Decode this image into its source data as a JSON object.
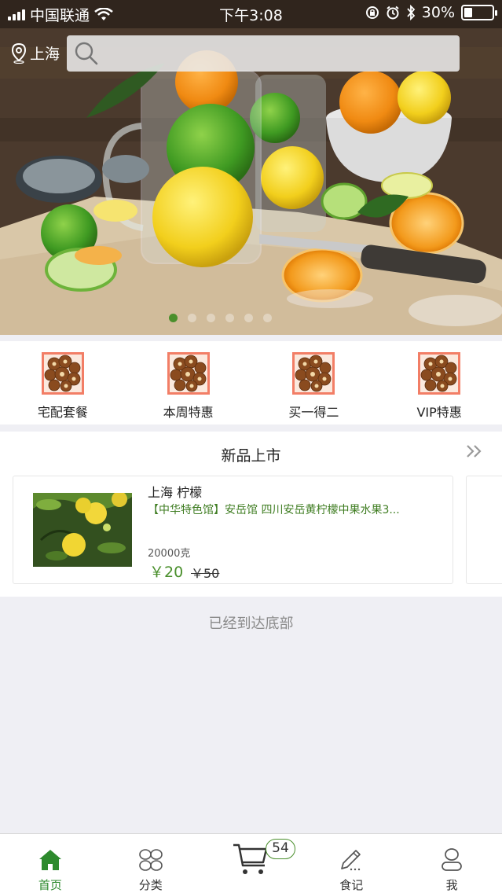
{
  "status_bar": {
    "carrier": "中国联通",
    "time": "下午3:08",
    "battery": "30%",
    "battery_level": 0.3
  },
  "header": {
    "location": "上海",
    "search_placeholder": ""
  },
  "banner": {
    "slide_count": 6,
    "active_slide": 1
  },
  "categories": [
    {
      "label": "宅配套餐",
      "icon": "pastry-thumbnail"
    },
    {
      "label": "本周特惠",
      "icon": "pastry-thumbnail"
    },
    {
      "label": "买一得二",
      "icon": "pastry-thumbnail"
    },
    {
      "label": "VIP特惠",
      "icon": "pastry-thumbnail"
    }
  ],
  "new_arrivals": {
    "title": "新品上市",
    "more_icon": "double-chevron-right",
    "products": [
      {
        "name": "上海 柠檬",
        "description": "【中华特色馆】安岳馆 四川安岳黄柠檬中果水果3...",
        "weight": "20000克",
        "price": "￥20",
        "original_price": "￥50"
      }
    ]
  },
  "footer_note": "已经到达底部",
  "tab_bar": {
    "tabs": [
      {
        "label": "首页",
        "icon": "home-icon",
        "active": true
      },
      {
        "label": "分类",
        "icon": "category-icon",
        "active": false
      },
      {
        "label": "",
        "icon": "cart-icon",
        "active": false
      },
      {
        "label": "食记",
        "icon": "pen-icon",
        "active": false
      },
      {
        "label": "我",
        "icon": "user-icon",
        "active": false
      }
    ],
    "cart_badge": "54"
  },
  "colors": {
    "accent_green": "#4a8f2c",
    "tab_active": "#2d8a2d",
    "description_green": "#3f7d22",
    "background": "#efeff4"
  }
}
